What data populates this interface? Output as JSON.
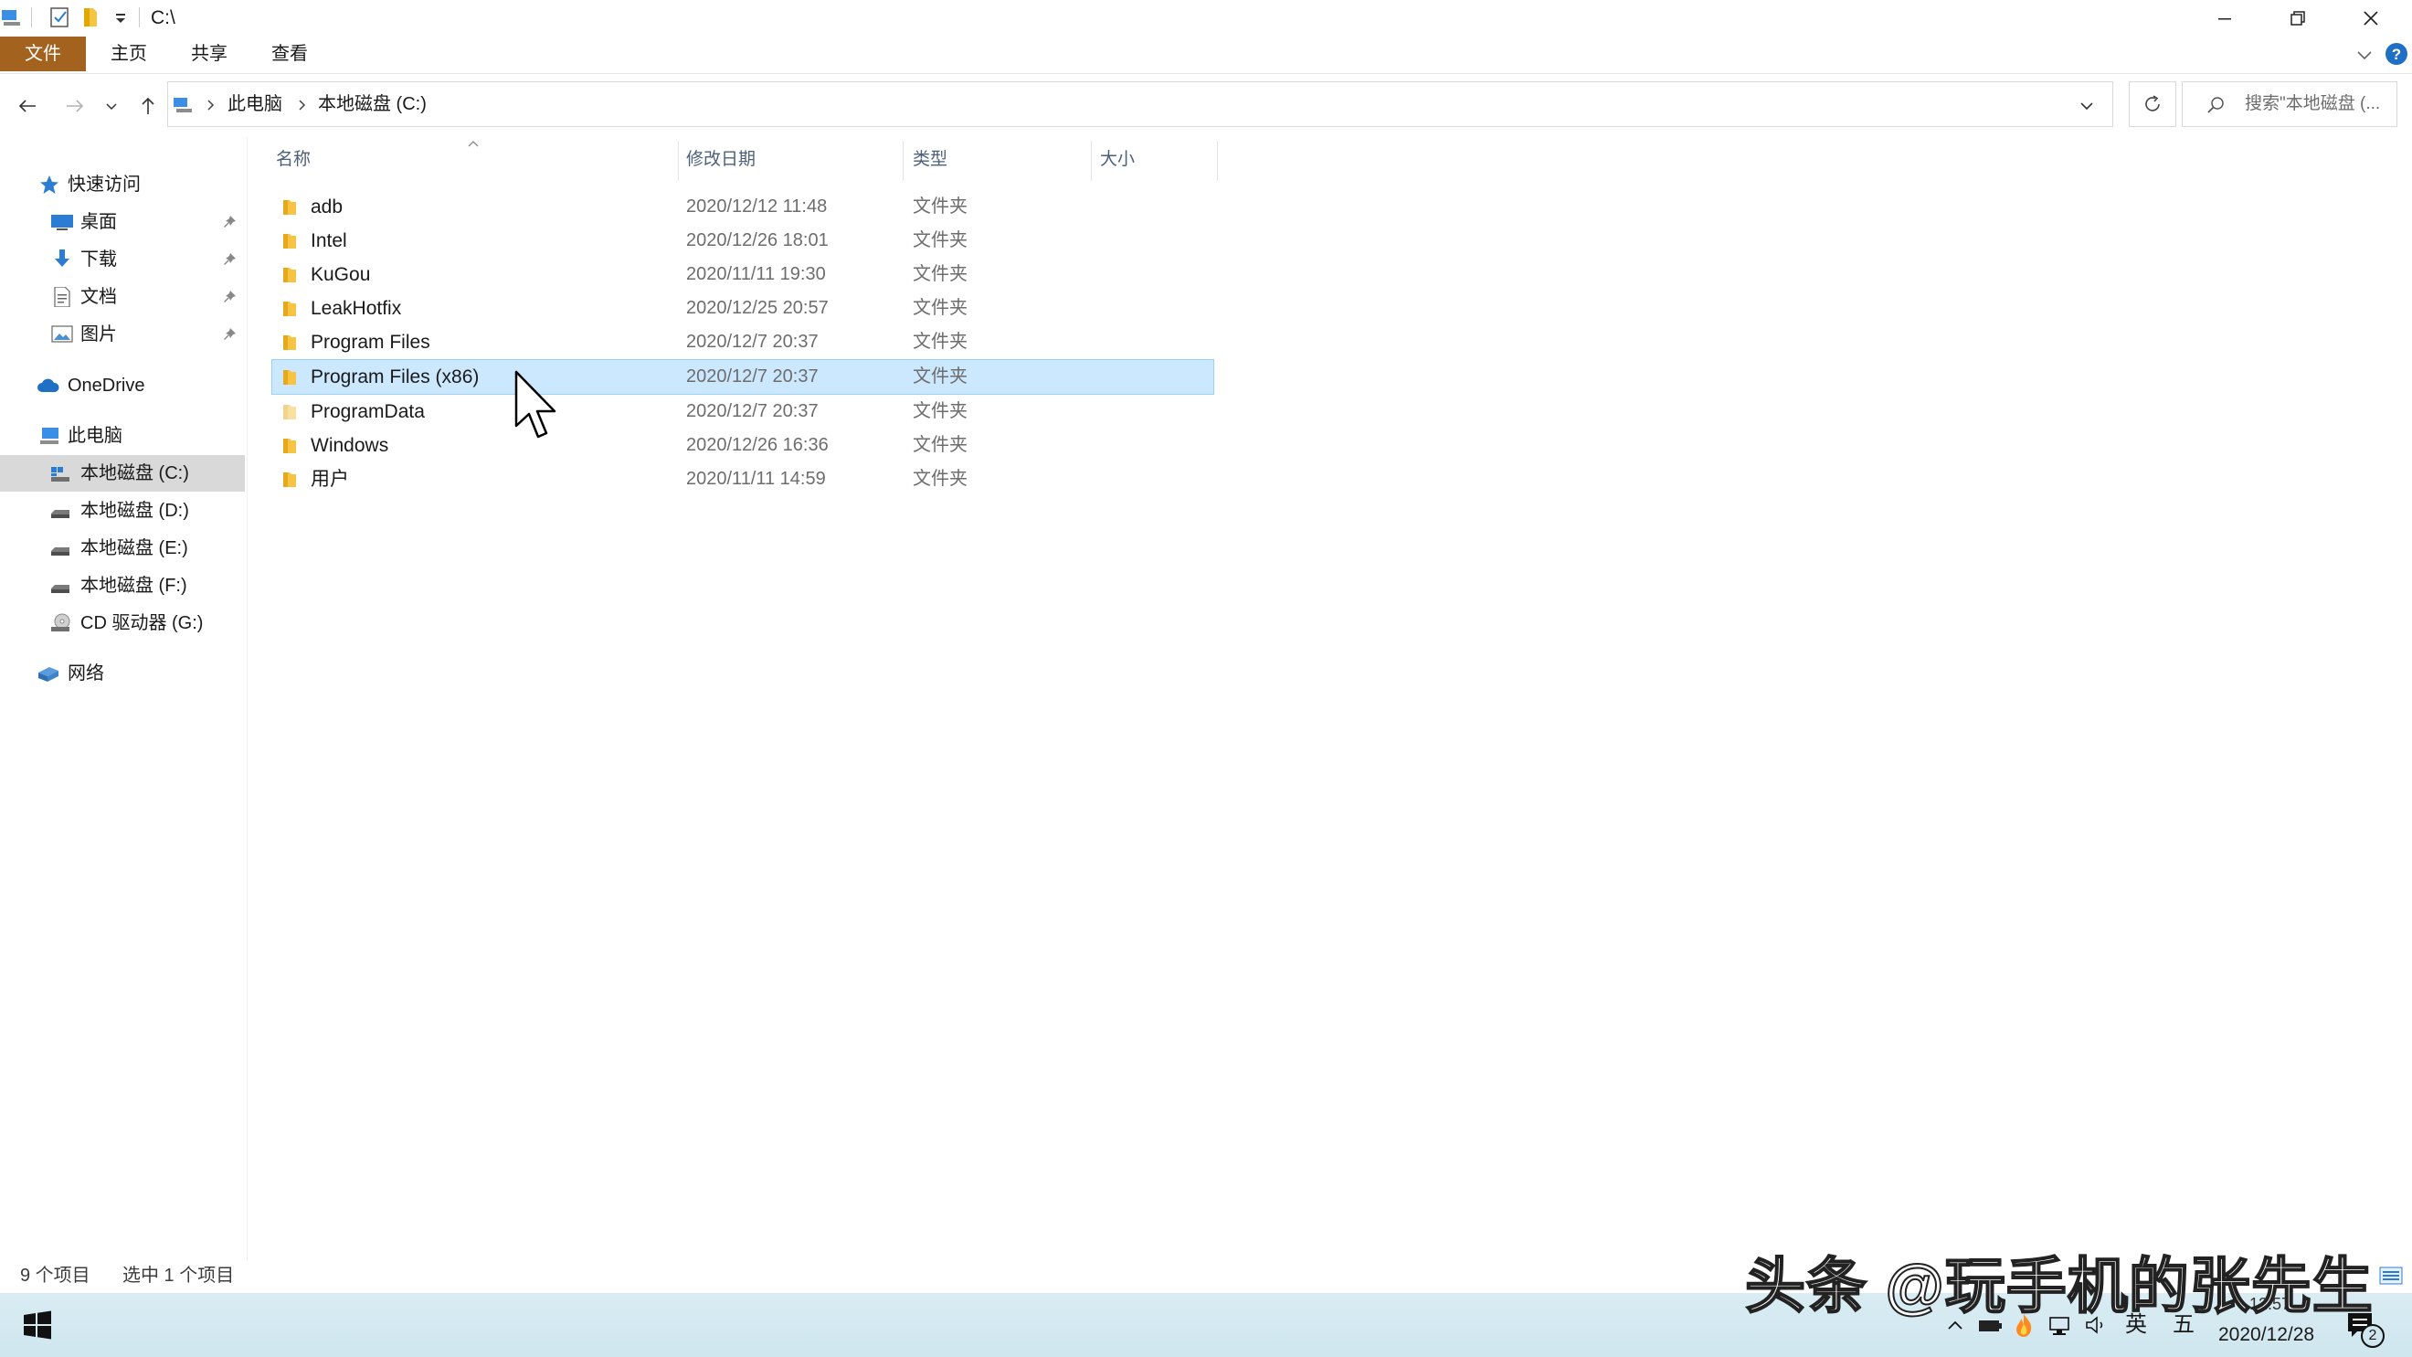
{
  "window": {
    "title": "C:\\",
    "minimize_label": "",
    "restore_label": "",
    "close_label": ""
  },
  "ribbon": {
    "tabs": [
      {
        "label": "文件",
        "active": true
      },
      {
        "label": "主页"
      },
      {
        "label": "共享"
      },
      {
        "label": "查看"
      }
    ],
    "accent_color": "#a4621f"
  },
  "address": {
    "crumbs": [
      "此电脑",
      "本地磁盘 (C:)"
    ],
    "search_placeholder": "搜索\"本地磁盘 (..."
  },
  "sidebar": {
    "quick_access": "快速访问",
    "pinned": [
      {
        "label": "桌面",
        "icon": "desktop-icon"
      },
      {
        "label": "下载",
        "icon": "download-icon"
      },
      {
        "label": "文档",
        "icon": "document-icon"
      },
      {
        "label": "图片",
        "icon": "picture-icon"
      }
    ],
    "onedrive": "OneDrive",
    "this_pc": "此电脑",
    "drives": [
      {
        "label": "本地磁盘 (C:)",
        "selected": true
      },
      {
        "label": "本地磁盘 (D:)"
      },
      {
        "label": "本地磁盘 (E:)"
      },
      {
        "label": "本地磁盘 (F:)"
      },
      {
        "label": "CD 驱动器 (G:)"
      }
    ],
    "network": "网络"
  },
  "columns": {
    "name": "名称",
    "date": "修改日期",
    "type": "类型",
    "size": "大小"
  },
  "files": [
    {
      "name": "adb",
      "date": "2020/12/12 11:48",
      "type": "文件夹"
    },
    {
      "name": "Intel",
      "date": "2020/12/26 18:01",
      "type": "文件夹"
    },
    {
      "name": "KuGou",
      "date": "2020/11/11 19:30",
      "type": "文件夹"
    },
    {
      "name": "LeakHotfix",
      "date": "2020/12/25 20:57",
      "type": "文件夹"
    },
    {
      "name": "Program Files",
      "date": "2020/12/7 20:37",
      "type": "文件夹"
    },
    {
      "name": "Program Files (x86)",
      "date": "2020/12/7 20:37",
      "type": "文件夹",
      "selected": true
    },
    {
      "name": "ProgramData",
      "date": "2020/12/7 20:37",
      "type": "文件夹"
    },
    {
      "name": "Windows",
      "date": "2020/12/26 16:36",
      "type": "文件夹"
    },
    {
      "name": "用户",
      "date": "2020/11/11 14:59",
      "type": "文件夹"
    }
  ],
  "status": {
    "item_count": "9 个项目",
    "selected_count": "选中 1 个项目"
  },
  "taskbar": {
    "ime_lang": "英",
    "ime_mode": "五",
    "time": "12:57",
    "date": "2020/12/28",
    "notification_count": "2"
  },
  "watermark": "头条 @玩手机的张先生"
}
